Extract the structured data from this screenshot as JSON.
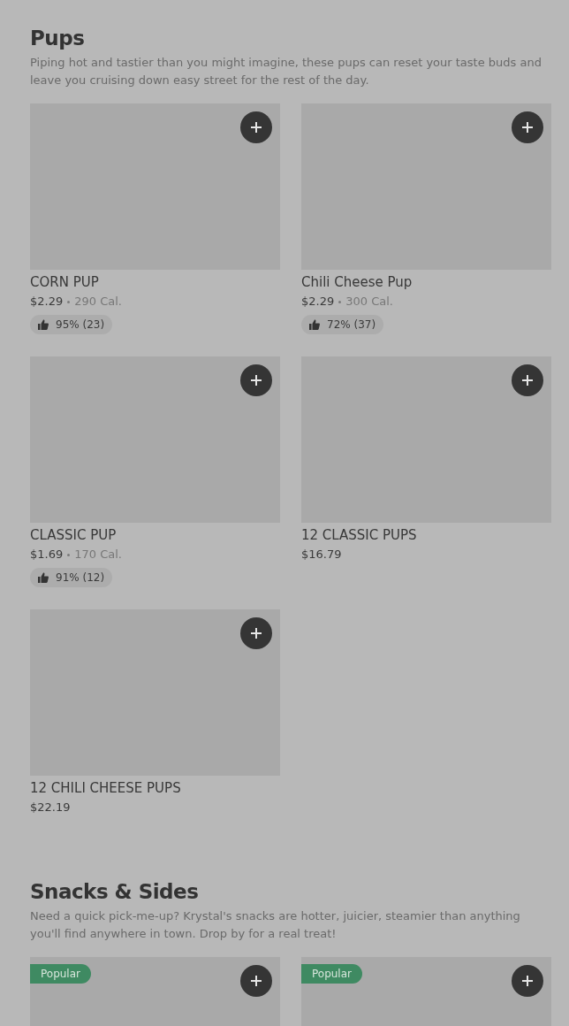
{
  "sections": [
    {
      "title": "Pups",
      "description": "Piping hot and tastier than you might imagine, these pups can reset your taste buds and leave you cruising down easy street for the rest of the day.",
      "items": [
        {
          "name": "CORN PUP",
          "price": "$2.29",
          "calories": "290 Cal.",
          "rating": "95% (23)"
        },
        {
          "name": "Chili Cheese Pup",
          "price": "$2.29",
          "calories": "300 Cal.",
          "rating": "72% (37)"
        },
        {
          "name": "CLASSIC PUP",
          "price": "$1.69",
          "calories": "170 Cal.",
          "rating": "91% (12)"
        },
        {
          "name": "12 CLASSIC PUPS",
          "price": "$16.79"
        },
        {
          "name": "12 CHILI CHEESE PUPS",
          "price": "$22.19"
        }
      ]
    },
    {
      "title": "Snacks & Sides",
      "description": "Need a quick pick-me-up? Krystal's snacks are hotter, juicier, steamier than anything you'll find anywhere in town. Drop by for a real treat!",
      "items": [
        {
          "badge": "Popular"
        },
        {
          "badge": "Popular"
        }
      ]
    }
  ]
}
